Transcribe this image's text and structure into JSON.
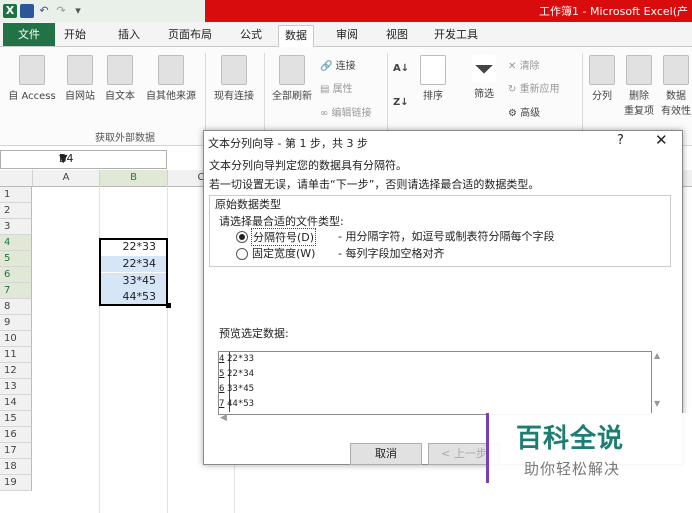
{
  "window": {
    "title": "工作簿1 - Microsoft Excel(产",
    "app_icon": "excel-icon",
    "quick_access": [
      "save-icon",
      "undo-icon",
      "redo-icon",
      "customize-icon"
    ]
  },
  "ribbon": {
    "tabs": [
      "文件",
      "开始",
      "插入",
      "页面布局",
      "公式",
      "数据",
      "审阅",
      "视图",
      "开发工具"
    ],
    "active_tab": "数据",
    "buttons": {
      "from_access": "自 Access",
      "from_web": "自网站",
      "from_text": "自文本",
      "from_other": "自其他来源",
      "existing": "现有连接",
      "refresh_all": "全部刷新",
      "connections": "连接",
      "properties": "属性",
      "edit_links": "编辑链接",
      "sort": "排序",
      "filter": "筛选",
      "clear": "清除",
      "reapply": "重新应用",
      "advanced": "高级",
      "split": "分列",
      "remove_dup1": "删除",
      "remove_dup2": "重复项",
      "validation1": "数据",
      "validation2": "有效性"
    },
    "group_label": "获取外部数据"
  },
  "formula_bar": {
    "namebox": "B4"
  },
  "sheet": {
    "columns": [
      "A",
      "B",
      "C"
    ],
    "rows": [
      "1",
      "2",
      "3",
      "4",
      "5",
      "6",
      "7",
      "8",
      "9",
      "10",
      "11",
      "12",
      "13",
      "14",
      "15",
      "16",
      "17",
      "18",
      "19"
    ],
    "cells": {
      "B4": "22*33",
      "B5": "22*34",
      "B6": "33*45",
      "B7": "44*53"
    }
  },
  "dialog": {
    "title": "文本分列向导 - 第 1 步，共 3 步",
    "help": "?",
    "close": "✕",
    "desc1": "文本分列向导判定您的数据具有分隔符。",
    "desc2": "若一切设置无误，请单击“下一步”，否则请选择最合适的数据类型。",
    "group_caption": "原始数据类型",
    "group_sub": "请选择最合适的文件类型:",
    "radio1_label": "分隔符号(D)",
    "radio1_desc": "- 用分隔字符，如逗号或制表符分隔每个字段",
    "radio2_label": "固定宽度(W)",
    "radio2_desc": "- 每列字段加空格对齐",
    "preview_label": "预览选定数据:",
    "preview_lines": [
      {
        "n": "4",
        "t": "22*33"
      },
      {
        "n": "5",
        "t": "22*34"
      },
      {
        "n": "6",
        "t": "33*45"
      },
      {
        "n": "7",
        "t": "44*53"
      }
    ],
    "cancel": "取消",
    "back": "< 上一步"
  },
  "watermark": {
    "title": "百科全说",
    "subtitle": "助你轻松解决"
  }
}
